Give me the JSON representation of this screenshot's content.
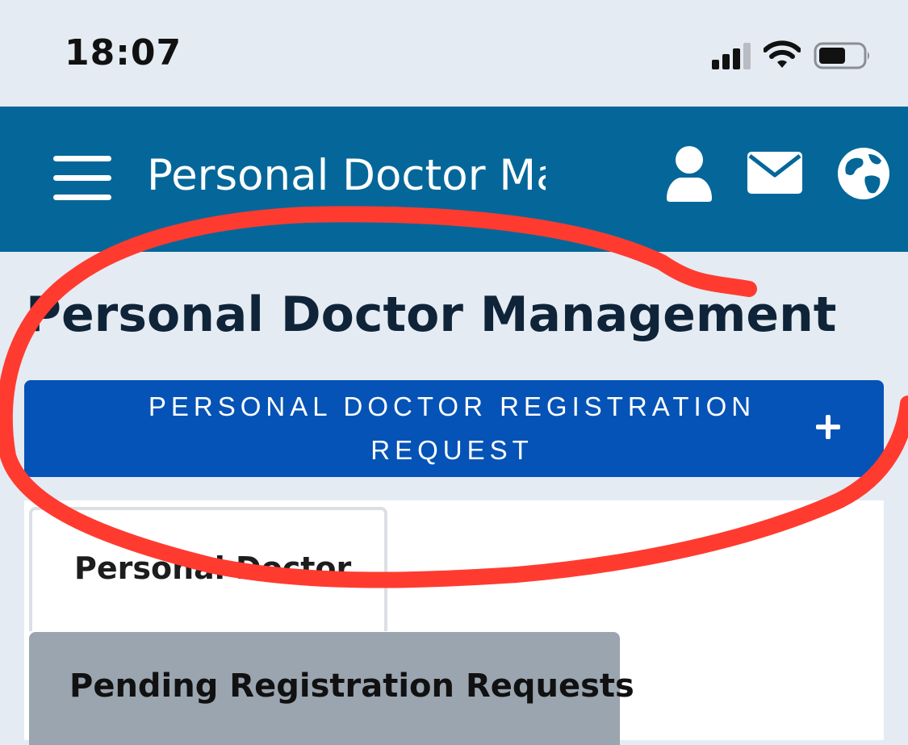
{
  "status_bar": {
    "time": "18:07",
    "icons": [
      "signal-icon",
      "wifi-icon",
      "battery-icon"
    ]
  },
  "header": {
    "title": "Personal Doctor Management",
    "menu_icon": "hamburger-menu-icon",
    "actions": [
      {
        "icon": "user-icon"
      },
      {
        "icon": "mail-icon"
      },
      {
        "icon": "globe-icon"
      }
    ],
    "background_color": "#056799"
  },
  "main": {
    "page_title": "Personal Doctor Management",
    "register_button": {
      "line1": "PERSONAL DOCTOR REGISTRATION",
      "line2": "REQUEST",
      "icon": "plus-icon",
      "color": "#0553b6"
    },
    "tabs": [
      {
        "label": "Personal Doctor"
      },
      {
        "label": "Pending Registration Requests"
      }
    ]
  },
  "annotation": {
    "shape": "freehand red circle",
    "color": "#ff3b30"
  }
}
